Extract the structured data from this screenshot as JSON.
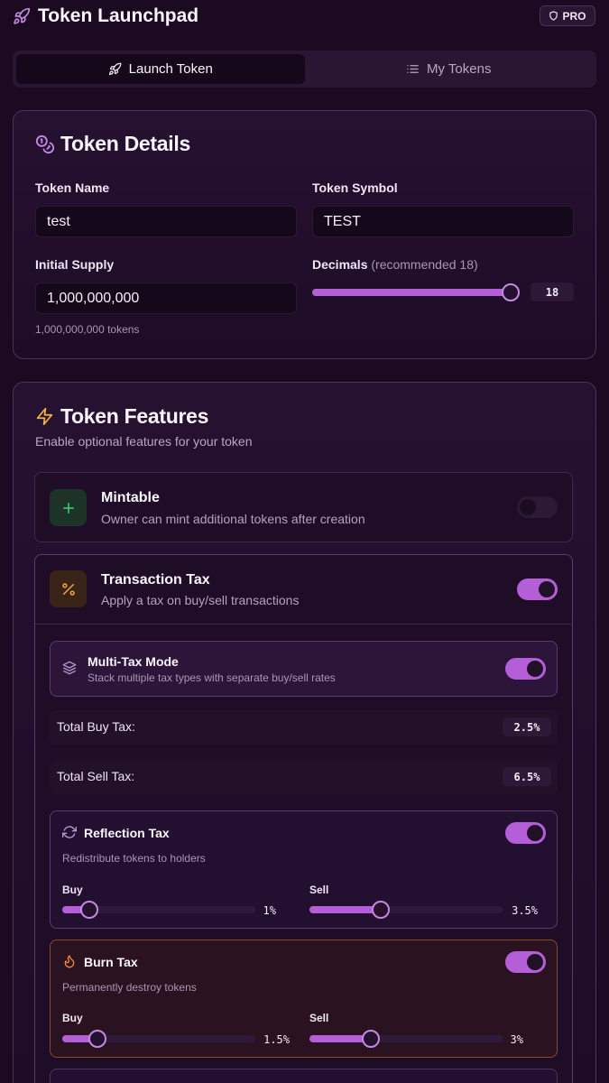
{
  "app": {
    "title": "Token Launchpad",
    "badge": "PRO"
  },
  "tabs": [
    {
      "label": "Launch Token",
      "active": true
    },
    {
      "label": "My Tokens",
      "active": false
    }
  ],
  "details": {
    "title": "Token Details",
    "name_label": "Token Name",
    "name_value": "test",
    "symbol_label": "Token Symbol",
    "symbol_value": "TEST",
    "supply_label": "Initial Supply",
    "supply_value": "1,000,000,000",
    "supply_hint": "1,000,000,000 tokens",
    "decimals_label": "Decimals",
    "decimals_hint": "(recommended 18)",
    "decimals_value": "18",
    "decimals_level": 1.0
  },
  "features": {
    "title": "Token Features",
    "subtitle": "Enable optional features for your token",
    "mintable": {
      "title": "Mintable",
      "desc": "Owner can mint additional tokens after creation",
      "enabled": false
    },
    "tax": {
      "title": "Transaction Tax",
      "desc": "Apply a tax on buy/sell transactions",
      "enabled": true,
      "multi": {
        "title": "Multi-Tax Mode",
        "desc": "Stack multiple tax types with separate buy/sell rates",
        "enabled": true
      },
      "total_buy_label": "Total Buy Tax:",
      "total_buy_value": "2.5%",
      "total_sell_label": "Total Sell Tax:",
      "total_sell_value": "6.5%",
      "reflection": {
        "title": "Reflection Tax",
        "desc": "Redistribute tokens to holders",
        "enabled": true,
        "buy_label": "Buy",
        "buy_value": "1%",
        "buy_level": 0.14,
        "sell_label": "Sell",
        "sell_value": "3.5%",
        "sell_level": 0.37
      },
      "burn": {
        "title": "Burn Tax",
        "desc": "Permanently destroy tokens",
        "enabled": true,
        "buy_label": "Buy",
        "buy_value": "1.5%",
        "buy_level": 0.18,
        "sell_label": "Sell",
        "sell_value": "3%",
        "sell_level": 0.32
      }
    }
  },
  "colors": {
    "accent": "#b45fd8",
    "background": "#1b0a22",
    "burn_border": "#8a4a2a"
  }
}
